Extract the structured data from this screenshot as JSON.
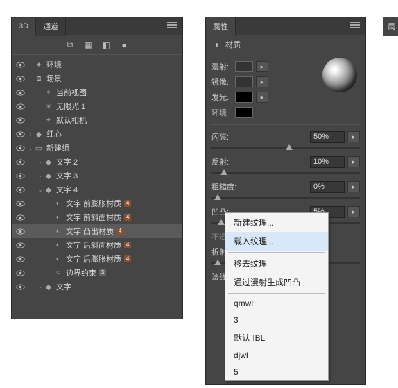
{
  "panel3d": {
    "tabs": [
      "3D",
      "通道"
    ],
    "toolbar_icons": [
      "filter-icon",
      "trash-icon",
      "mask-icon",
      "light-icon"
    ],
    "tree": [
      {
        "vis": true,
        "depth": 0,
        "arrow": "",
        "icon": "env",
        "label": "环境"
      },
      {
        "vis": true,
        "depth": 0,
        "arrow": "",
        "icon": "scene",
        "label": "场景"
      },
      {
        "vis": true,
        "depth": 1,
        "arrow": "",
        "icon": "camera",
        "label": "当前视图"
      },
      {
        "vis": true,
        "depth": 1,
        "arrow": "",
        "icon": "light",
        "label": "无限光 1"
      },
      {
        "vis": true,
        "depth": 1,
        "arrow": "",
        "icon": "camera",
        "label": "默认相机"
      },
      {
        "vis": true,
        "depth": 0,
        "arrow": ">",
        "icon": "mesh",
        "label": "红心"
      },
      {
        "vis": true,
        "depth": 0,
        "arrow": "v",
        "icon": "group",
        "label": "新建组"
      },
      {
        "vis": true,
        "depth": 1,
        "arrow": ">",
        "icon": "mesh",
        "label": "文字 2"
      },
      {
        "vis": true,
        "depth": 1,
        "arrow": ">",
        "icon": "mesh",
        "label": "文字 3"
      },
      {
        "vis": true,
        "depth": 1,
        "arrow": "v",
        "icon": "mesh",
        "label": "文字 4"
      },
      {
        "vis": true,
        "depth": 2,
        "arrow": "",
        "icon": "material",
        "label": "文字 前膨胀材质",
        "badge": "4"
      },
      {
        "vis": true,
        "depth": 2,
        "arrow": "",
        "icon": "material",
        "label": "文字 前斜面材质",
        "badge": "4"
      },
      {
        "vis": true,
        "depth": 2,
        "arrow": "",
        "icon": "material",
        "label": "文字 凸出材质",
        "badge": "4",
        "selected": true
      },
      {
        "vis": true,
        "depth": 2,
        "arrow": "",
        "icon": "material",
        "label": "文字 后斜面材质",
        "badge": "4"
      },
      {
        "vis": true,
        "depth": 2,
        "arrow": "",
        "icon": "material",
        "label": "文字 后膨胀材质",
        "badge": "4"
      },
      {
        "vis": true,
        "depth": 2,
        "arrow": "",
        "icon": "constr",
        "label": "边界约束",
        "badge": "3",
        "badgeGray": true
      },
      {
        "vis": true,
        "depth": 1,
        "arrow": ">",
        "icon": "mesh",
        "label": "文字"
      }
    ]
  },
  "props": {
    "tab": "属性",
    "sub_icon": "material-icon",
    "sub_label": "材质",
    "rows": {
      "diffuse": "漫射:",
      "specular": "镜像:",
      "emission": "发光:",
      "ambient_cut": "环境"
    },
    "sliders": [
      {
        "label": "闪亮:",
        "value": "50%",
        "thumb": 50,
        "folder": true
      },
      {
        "label": "反射:",
        "value": "10%",
        "thumb": 6,
        "folder": true
      },
      {
        "label": "粗糙度:",
        "value": "0%",
        "thumb": 2,
        "folder": true
      },
      {
        "label": "凹凸:",
        "value": "5%",
        "thumb": 4,
        "folder": true
      },
      {
        "label": "不透明度",
        "value": "",
        "thumb": null,
        "folder": false,
        "dim": true
      },
      {
        "label": "折射:",
        "value": "",
        "thumb": 2,
        "folder": false
      },
      {
        "label": "法线:",
        "value": "",
        "thumb": null,
        "folder": false
      }
    ]
  },
  "ctx": {
    "items": [
      {
        "label": "新建纹理...",
        "type": "item"
      },
      {
        "label": "载入纹理...",
        "type": "item",
        "hover": true
      },
      {
        "type": "sep"
      },
      {
        "label": "移去纹理",
        "type": "item"
      },
      {
        "label": "通过漫射生成凹凸",
        "type": "item"
      },
      {
        "type": "sep"
      },
      {
        "label": "qmwl",
        "type": "item"
      },
      {
        "label": "3",
        "type": "item"
      },
      {
        "label": "默认 IBL",
        "type": "item"
      },
      {
        "label": "djwl",
        "type": "item"
      },
      {
        "label": "5",
        "type": "item"
      }
    ]
  },
  "extra_tab": "属"
}
